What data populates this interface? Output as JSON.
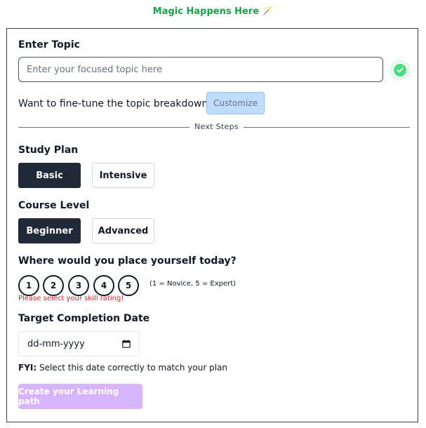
{
  "header": {
    "title": "Magic Happens Here",
    "icon": "magic-wand-icon"
  },
  "topic": {
    "label": "Enter Topic",
    "placeholder": "Enter your focused topic here",
    "value": "",
    "status_icon": "check-circle-icon"
  },
  "finetune": {
    "question": "Want to fine-tune the topic breakdown?",
    "button": "Customize"
  },
  "divider": {
    "label": "Next Steps"
  },
  "study_plan": {
    "label": "Study Plan",
    "options": [
      "Basic",
      "Intensive"
    ],
    "selected": "Basic"
  },
  "course_level": {
    "label": "Course Level",
    "options": [
      "Beginner",
      "Advanced"
    ],
    "selected": "Beginner"
  },
  "skill": {
    "question": "Where would you place yourself today?",
    "options": [
      "1",
      "2",
      "3",
      "4",
      "5"
    ],
    "hint": "(1 = Novice, 5 = Expert)",
    "error": "Please select your skill rating!"
  },
  "target_date": {
    "label": "Target Completion Date",
    "placeholder": "dd-mm-yyyy",
    "icon": "calendar-icon"
  },
  "fyi": {
    "prefix": "FYI:",
    "text": " Select this date correctly to match your plan"
  },
  "submit": {
    "label": "Create your Learning path"
  },
  "colors": {
    "accent_green": "#16a34a",
    "dark_button": "#1f2937",
    "error_red": "#dc2626",
    "submit_purple": "#d8b4fe",
    "customize_blue": "#bfdbfe"
  }
}
